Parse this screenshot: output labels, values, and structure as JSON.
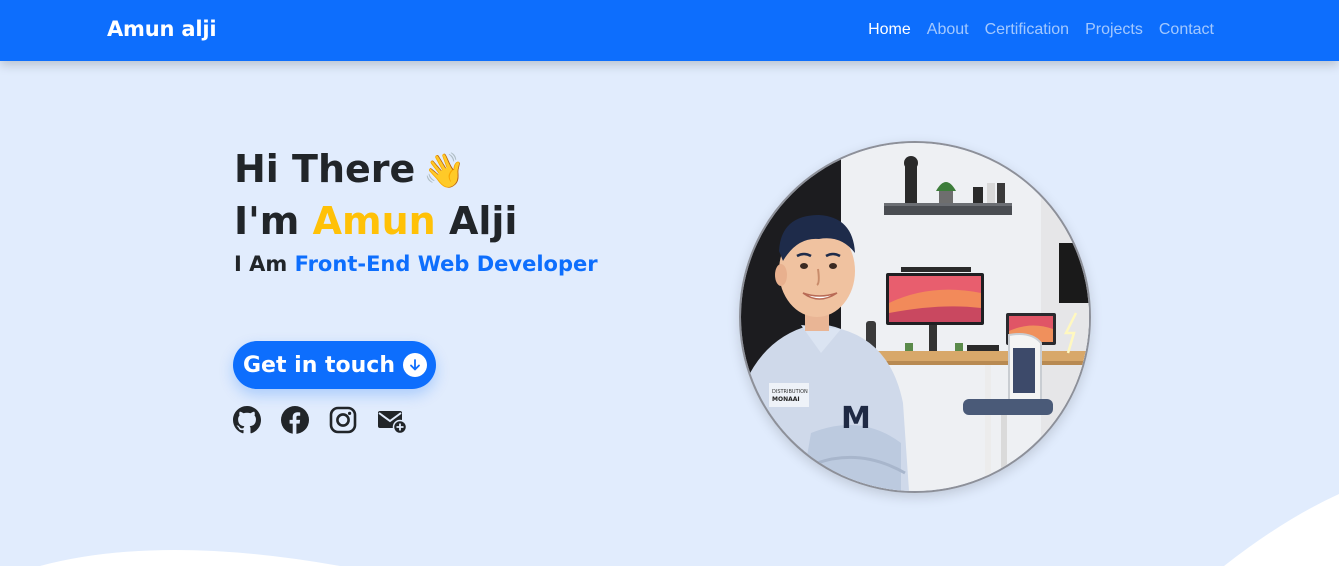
{
  "brand": "Amun alji",
  "nav": {
    "items": [
      {
        "label": "Home",
        "active": true
      },
      {
        "label": "About",
        "active": false
      },
      {
        "label": "Certification",
        "active": false
      },
      {
        "label": "Projects",
        "active": false
      },
      {
        "label": "Contact",
        "active": false
      }
    ]
  },
  "hero": {
    "greeting": "Hi There",
    "wave_emoji": "👋",
    "im_prefix": "I'm",
    "first_name": "Amun",
    "last_name": "Alji",
    "role_prefix": "I Am",
    "role": "Front-End Web Developer",
    "cta_label": "Get in touch"
  },
  "socials": [
    {
      "name": "github-icon"
    },
    {
      "name": "facebook-icon"
    },
    {
      "name": "instagram-icon"
    },
    {
      "name": "mail-icon"
    }
  ],
  "avatar": {
    "shirt_badge_line1": "DISTRIBUTION",
    "shirt_badge_line2": "MONAAI",
    "chest_logo": "M"
  },
  "colors": {
    "primary": "#0d6efd",
    "accent": "#ffc107",
    "background": "#e1ecfd",
    "text": "#212529"
  }
}
